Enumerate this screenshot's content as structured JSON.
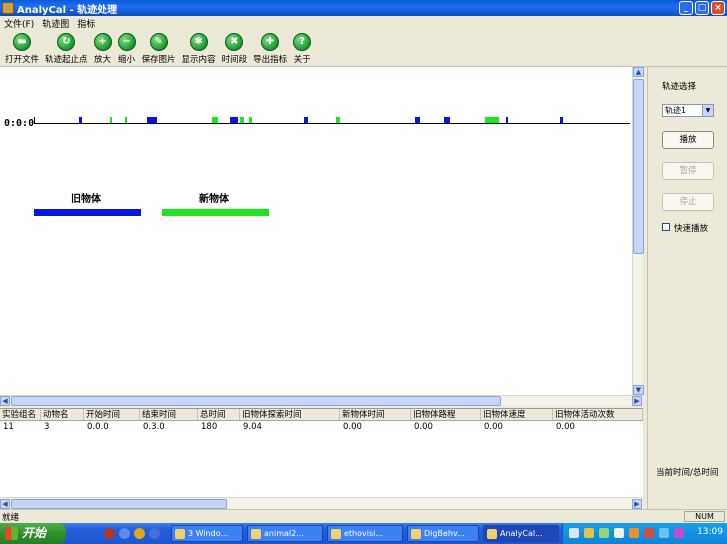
{
  "window": {
    "title": "AnalyCal - 轨迹处理",
    "min_label": "_",
    "max_label": "□",
    "close_label": "×"
  },
  "menu": [
    "文件(F)",
    "轨迹图",
    "指标"
  ],
  "toolbar": [
    {
      "label": "打开文件",
      "icon": "open-file-icon",
      "glyph": "▬"
    },
    {
      "label": "轨迹起止点",
      "icon": "refresh-icon",
      "glyph": "↻"
    },
    {
      "label": "放大",
      "icon": "zoom-in-icon",
      "glyph": "+"
    },
    {
      "label": "缩小",
      "icon": "zoom-out-icon",
      "glyph": "−"
    },
    {
      "label": "保存图片",
      "icon": "save-image-icon",
      "glyph": "✎"
    },
    {
      "label": "显示内容",
      "icon": "show-content-icon",
      "glyph": "✱"
    },
    {
      "label": "时间段",
      "icon": "time-segment-icon",
      "glyph": "✖"
    },
    {
      "label": "导出指标",
      "icon": "export-icon",
      "glyph": "✚"
    },
    {
      "label": "关于",
      "icon": "help-icon",
      "glyph": "?"
    }
  ],
  "timeline": {
    "start_time": "0:0:0",
    "old_color": "#0a14e0",
    "new_color": "#1ee61e",
    "segments": [
      {
        "start": 0.076,
        "width": 0.004,
        "kind": "old"
      },
      {
        "start": 0.127,
        "width": 0.004,
        "kind": "new"
      },
      {
        "start": 0.152,
        "width": 0.004,
        "kind": "new"
      },
      {
        "start": 0.19,
        "width": 0.017,
        "kind": "old"
      },
      {
        "start": 0.299,
        "width": 0.01,
        "kind": "new"
      },
      {
        "start": 0.329,
        "width": 0.013,
        "kind": "old"
      },
      {
        "start": 0.346,
        "width": 0.006,
        "kind": "new"
      },
      {
        "start": 0.361,
        "width": 0.004,
        "kind": "new"
      },
      {
        "start": 0.453,
        "width": 0.006,
        "kind": "old"
      },
      {
        "start": 0.506,
        "width": 0.008,
        "kind": "new"
      },
      {
        "start": 0.64,
        "width": 0.007,
        "kind": "old"
      },
      {
        "start": 0.688,
        "width": 0.01,
        "kind": "old"
      },
      {
        "start": 0.757,
        "width": 0.024,
        "kind": "new"
      },
      {
        "start": 0.792,
        "width": 0.003,
        "kind": "old"
      },
      {
        "start": 0.883,
        "width": 0.004,
        "kind": "old"
      }
    ]
  },
  "legend": {
    "old_label": "旧物体",
    "new_label": "新物体"
  },
  "right_panel": {
    "track_select_label": "轨迹选择",
    "track_value": "轨迹1",
    "play_label": "播放",
    "pause_label": "暂停",
    "stop_label": "停止",
    "fast_play_label": "快速播放",
    "current_time_label": "当前时间/总时间"
  },
  "table": {
    "headers": [
      "实验组名",
      "动物名",
      "开始时间",
      "结束时间",
      "总时间",
      "旧物体探索时间",
      "新物体时间",
      "旧物体路程",
      "旧物体速度",
      "旧物体活动次数"
    ],
    "rows": [
      [
        "11",
        "3",
        "0.0.0",
        "0.3.0",
        "180",
        "9.04",
        "0.00",
        "0.00",
        "0.00",
        "0.00"
      ]
    ]
  },
  "statusbar": {
    "status": "就绪",
    "num": "NUM"
  },
  "taskbar": {
    "start_label": "开始",
    "tasks": [
      "3 Windo...",
      "animal2...",
      "ethovisi...",
      "DigBehv...",
      "AnalyCal..."
    ],
    "clock": "13:09"
  }
}
